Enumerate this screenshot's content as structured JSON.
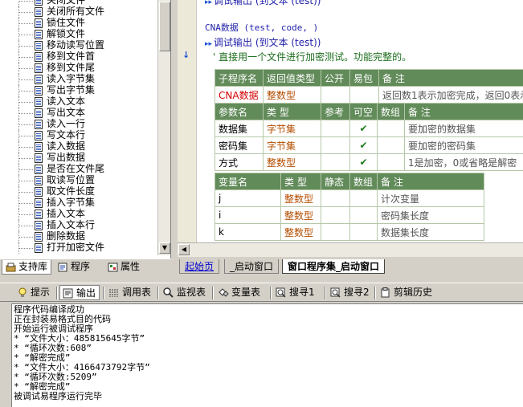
{
  "tree": {
    "items": [
      "关闭文件",
      "关闭所有文件",
      "锁住文件",
      "解锁文件",
      "移动读写位置",
      "移到文件首",
      "移到文件尾",
      "读入字节集",
      "写出字节集",
      "读入文本",
      "写出文本",
      "读入一行",
      "写文本行",
      "读入数据",
      "写出数据",
      "是否在文件尾",
      "取读写位置",
      "取文件长度",
      "插入字节集",
      "插入文本",
      "插入文本行",
      "删除数据",
      "打开加密文件"
    ]
  },
  "left_tabs": {
    "support": "支持库",
    "program": "程序",
    "property": "属性"
  },
  "code": {
    "line_top": "调试输出 (到文本 (test))",
    "line_cna": "CNA数据 (test, code, )",
    "line_debug": "调试输出 (到文本 (test))",
    "line_comment": "' 直接用一个文件进行加密测试。功能完整的。"
  },
  "sub_header": {
    "cols": [
      "子程序名",
      "返回值类型",
      "公开",
      "易包",
      "备 注"
    ],
    "name": "CNA数据",
    "ret_type": "整数型",
    "public": "",
    "easy": "",
    "note": "返回数1表示加密完成，返回0表示"
  },
  "params": {
    "cols": [
      "参数名",
      "类 型",
      "参考",
      "可空",
      "数组",
      "备 注"
    ],
    "rows": [
      {
        "name": "数据集",
        "type": "字节集",
        "ref": "",
        "nullable": "✔",
        "arr": "",
        "note": "要加密的数据集"
      },
      {
        "name": "密码集",
        "type": "字节集",
        "ref": "",
        "nullable": "✔",
        "arr": "",
        "note": "要加密的密码集"
      },
      {
        "name": "方式",
        "type": "整数型",
        "ref": "",
        "nullable": "✔",
        "arr": "",
        "note": "1是加密，0或省略是解密"
      }
    ]
  },
  "vars": {
    "cols": [
      "变量名",
      "类 型",
      "静态",
      "数组",
      "备 注"
    ],
    "rows": [
      {
        "name": "j",
        "type": "整数型",
        "note": "计次变量"
      },
      {
        "name": "i",
        "type": "整数型",
        "note": "密码集长度"
      },
      {
        "name": "k",
        "type": "整数型",
        "note": "数据集长度"
      }
    ]
  },
  "editor_tabs": {
    "start": "起始页",
    "window1": "_启动窗口",
    "window2": "窗口程序集_启动窗口"
  },
  "toolbar": {
    "hint": "提示",
    "output": "输出",
    "call_table": "调用表",
    "watch": "监视表",
    "var_table": "变量表",
    "search1": "搜寻1",
    "search2": "搜寻2",
    "clip_history": "剪辑历史"
  },
  "output": {
    "lines": [
      "程序代码编译成功",
      "正在封装易格式目的代码",
      "开始运行被调试程序",
      "* “文件大小：485815645字节”",
      "* “循环次数:608”",
      "* “解密完成”",
      "* “文件大小：4166473792字节”",
      "* “循环次数:5209”",
      "* “解密完成”",
      "被调试易程序运行完毕"
    ]
  }
}
